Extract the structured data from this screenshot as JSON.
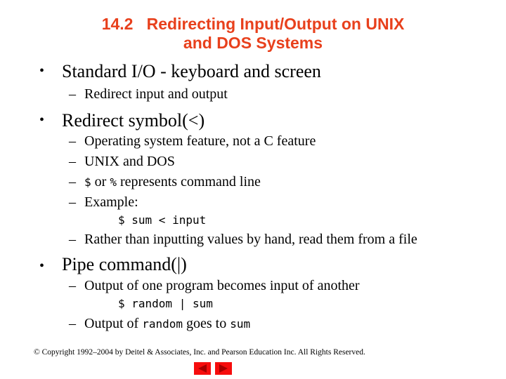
{
  "slide": {
    "title_line1": "14.2   Redirecting Input/Output on UNIX",
    "title_line2": "and DOS Systems",
    "bullets": [
      {
        "text": "Standard I/O - keyboard and screen",
        "subitems": [
          "Redirect input and output"
        ]
      },
      {
        "text": "Redirect symbol(<)",
        "subitems": [
          "Operating system feature, not a C feature",
          "UNIX and DOS",
          {
            "code1": "$",
            "text1": " or ",
            "code2": "%",
            "text2": " represents command line"
          },
          "Example:",
          "Rather than inputting values by hand, read them from a file"
        ],
        "code_example": "$ sum < input"
      },
      {
        "text": "Pipe command(|)",
        "subitems": [
          "Output of one program becomes input of another",
          {
            "text1": "Output of ",
            "code1": "random",
            "text2": " goes to ",
            "code2": "sum"
          }
        ],
        "code_example": "$ random | sum"
      }
    ],
    "copyright": "© Copyright 1992–2004 by Deitel & Associates, Inc. and Pearson Education Inc. All Rights Reserved.",
    "nav": {
      "prev_icon": "prev-arrow-icon",
      "next_icon": "next-arrow-icon",
      "button_color": "#f60d0d",
      "arrow_color": "#a80000"
    },
    "title_color": "#e8401c"
  }
}
